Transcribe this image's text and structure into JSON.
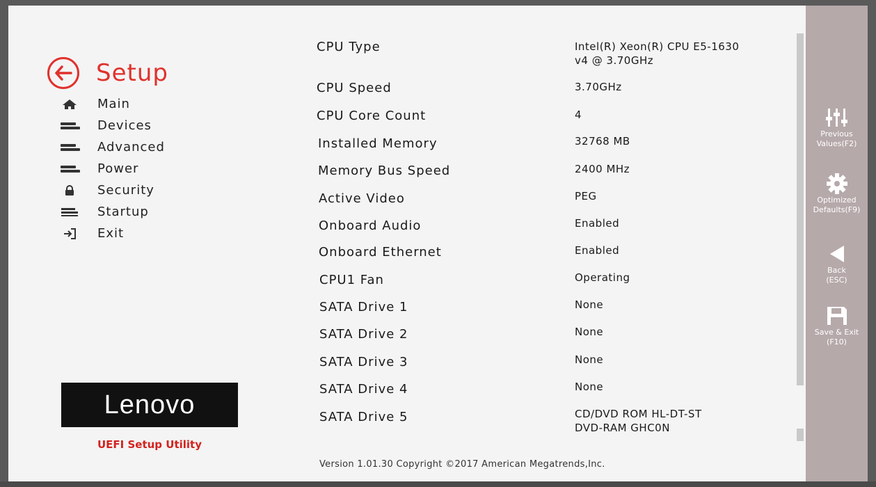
{
  "sidebar": {
    "title": "Setup",
    "items": [
      {
        "label": "Main",
        "icon": "home-icon"
      },
      {
        "label": "Devices",
        "icon": "bars-icon"
      },
      {
        "label": "Advanced",
        "icon": "bars-icon"
      },
      {
        "label": "Power",
        "icon": "bars-icon"
      },
      {
        "label": "Security",
        "icon": "lock-icon"
      },
      {
        "label": "Startup",
        "icon": "startup-icon"
      },
      {
        "label": "Exit",
        "icon": "exit-icon"
      }
    ],
    "logo": "Lenovo",
    "subtitle": "UEFI Setup Utility"
  },
  "info": [
    {
      "label": "CPU Type",
      "value": "Intel(R) Xeon(R) CPU E5-1630",
      "value2": "v4 @ 3.70GHz"
    },
    {
      "label": "CPU Speed",
      "value": "3.70GHz",
      "value2": ""
    },
    {
      "label": "CPU Core Count",
      "value": "4",
      "value2": ""
    },
    {
      "label": "Installed Memory",
      "value": "32768 MB",
      "value2": ""
    },
    {
      "label": "Memory Bus Speed",
      "value": "2400 MHz",
      "value2": ""
    },
    {
      "label": "Active Video",
      "value": "PEG",
      "value2": ""
    },
    {
      "label": "Onboard Audio",
      "value": "Enabled",
      "value2": ""
    },
    {
      "label": "Onboard Ethernet",
      "value": "Enabled",
      "value2": ""
    },
    {
      "label": "CPU1 Fan",
      "value": "Operating",
      "value2": ""
    },
    {
      "label": "SATA Drive 1",
      "value": "None",
      "value2": ""
    },
    {
      "label": "SATA Drive 2",
      "value": "None",
      "value2": ""
    },
    {
      "label": "SATA Drive 3",
      "value": "None",
      "value2": ""
    },
    {
      "label": "SATA Drive 4",
      "value": "None",
      "value2": ""
    },
    {
      "label": "SATA Drive 5",
      "value": "CD/DVD ROM HL-DT-ST",
      "value2": "DVD-RAM GHC0N"
    }
  ],
  "footer": "Version 1.01.30 Copyright ©2017 American Megatrends,Inc.",
  "rightbar": {
    "previous": {
      "line1": "Previous",
      "line2": "Values(F2)"
    },
    "optimized": {
      "line1": "Optimized",
      "line2": "Defaults(F9)"
    },
    "back": {
      "line1": "Back",
      "line2": "(ESC)"
    },
    "save": {
      "line1": "Save & Exit",
      "line2": "(F10)"
    }
  },
  "colors": {
    "accent": "#e0322d",
    "sidebar_bg": "#b6a9aa"
  }
}
